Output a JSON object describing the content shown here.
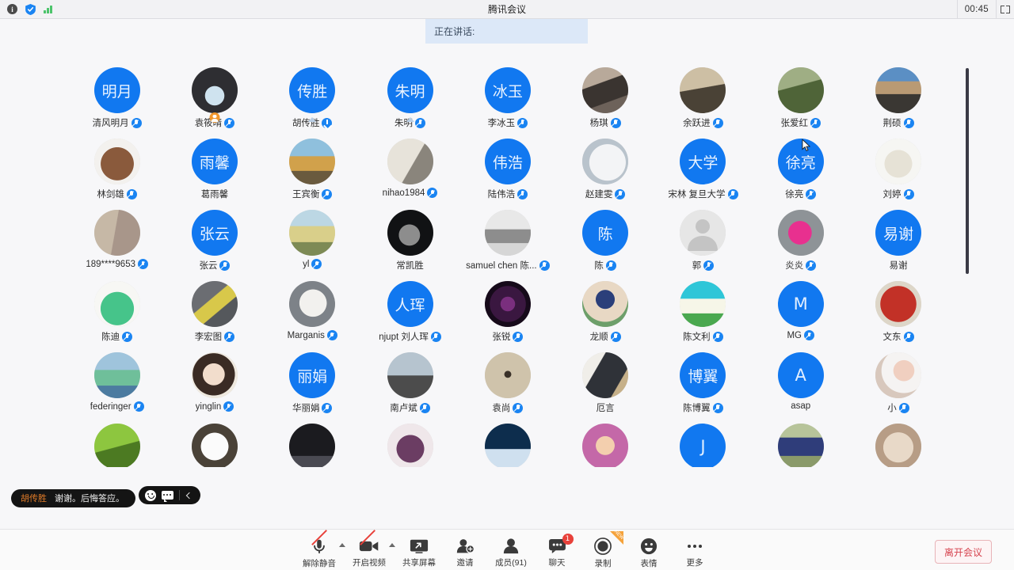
{
  "titlebar": {
    "title": "腾讯会议",
    "timer": "00:45",
    "info_icon": "info-icon",
    "shield_icon": "shield-icon",
    "signal_icon": "signal-bars-icon",
    "expand_icon": "fullscreen-icon"
  },
  "speaking_banner": {
    "text": "正在讲话:"
  },
  "participants": [
    {
      "name": "清风明月",
      "avatar_type": "initial",
      "initials": "明月",
      "mic": "muted"
    },
    {
      "name": "袁筱晴",
      "avatar_type": "photo",
      "photo": "dark-portrait",
      "mic": "muted",
      "badge": "host"
    },
    {
      "name": "胡传胜",
      "avatar_type": "initial",
      "initials": "传胜",
      "mic": "arrow",
      "badge": "triangle"
    },
    {
      "name": "朱明",
      "avatar_type": "initial",
      "initials": "朱明",
      "mic": "muted",
      "badge": "triangle"
    },
    {
      "name": "李冰玉",
      "avatar_type": "initial",
      "initials": "冰玉",
      "mic": "muted"
    },
    {
      "name": "杨琪",
      "avatar_type": "photo",
      "photo": "street-scene",
      "mic": "muted"
    },
    {
      "name": "余跃进",
      "avatar_type": "photo",
      "photo": "sphinx-man",
      "mic": "muted"
    },
    {
      "name": "张爱红",
      "avatar_type": "photo",
      "photo": "cyclist",
      "mic": "muted"
    },
    {
      "name": "荆硕",
      "avatar_type": "photo",
      "photo": "dog-desert",
      "mic": "muted"
    },
    {
      "name": "林剑雄",
      "avatar_type": "photo",
      "photo": "brown-bear",
      "mic": "muted"
    },
    {
      "name": "葛雨馨",
      "avatar_type": "initial",
      "initials": "雨馨",
      "mic": "none"
    },
    {
      "name": "王宾衡",
      "avatar_type": "photo",
      "photo": "bigben-autumn",
      "mic": "muted"
    },
    {
      "name": "nihao1984",
      "avatar_type": "photo",
      "photo": "calligraphy",
      "mic": "muted"
    },
    {
      "name": "陆伟浩",
      "avatar_type": "initial",
      "initials": "伟浩",
      "mic": "muted"
    },
    {
      "name": "赵建雯",
      "avatar_type": "photo",
      "photo": "white-cat-flower",
      "mic": "muted"
    },
    {
      "name": "宋林 复旦大学",
      "avatar_type": "initial",
      "initials": "大学",
      "mic": "muted"
    },
    {
      "name": "徐亮",
      "avatar_type": "initial",
      "initials": "徐亮",
      "mic": "muted"
    },
    {
      "name": "刘婷",
      "avatar_type": "photo",
      "photo": "illustration-girl",
      "mic": "muted"
    },
    {
      "name": "189****9653",
      "avatar_type": "photo",
      "photo": "red-ribbon",
      "mic": "muted"
    },
    {
      "name": "张云",
      "avatar_type": "initial",
      "initials": "张云",
      "mic": "muted"
    },
    {
      "name": "yl",
      "avatar_type": "photo",
      "photo": "field-landscape",
      "mic": "muted"
    },
    {
      "name": "常凯胜",
      "avatar_type": "photo",
      "photo": "man-glasses-dark",
      "mic": "none"
    },
    {
      "name": "samuel chen 陈...",
      "avatar_type": "photo",
      "photo": "bw-dancing",
      "mic": "muted"
    },
    {
      "name": "陈",
      "avatar_type": "initial",
      "initials": "陈",
      "mic": "muted"
    },
    {
      "name": "郭",
      "avatar_type": "photo",
      "photo": "default-user",
      "mic": "muted"
    },
    {
      "name": "炎炎",
      "avatar_type": "photo",
      "photo": "pink-flower",
      "mic": "muted"
    },
    {
      "name": "易谢",
      "avatar_type": "initial",
      "initials": "易谢",
      "mic": "none"
    },
    {
      "name": "陈迪",
      "avatar_type": "photo",
      "photo": "cartoon-dino-girl",
      "mic": "muted"
    },
    {
      "name": "李宏图",
      "avatar_type": "photo",
      "photo": "yellow-blossom",
      "mic": "muted"
    },
    {
      "name": "Marganis",
      "avatar_type": "photo",
      "photo": "cartoon-wolf",
      "mic": "muted"
    },
    {
      "name": "njupt 刘人珲",
      "avatar_type": "initial",
      "initials": "人珲",
      "mic": "muted"
    },
    {
      "name": "张锐",
      "avatar_type": "photo",
      "photo": "purple-mandala",
      "mic": "muted"
    },
    {
      "name": "龙顺",
      "avatar_type": "photo",
      "photo": "cartoon-boy-hat",
      "mic": "muted"
    },
    {
      "name": "陈文利",
      "avatar_type": "photo",
      "photo": "daisy-lake",
      "mic": "muted"
    },
    {
      "name": "MG",
      "avatar_type": "initial",
      "initials": "M",
      "mic": "muted"
    },
    {
      "name": "文东",
      "avatar_type": "photo",
      "photo": "red-seal",
      "mic": "muted"
    },
    {
      "name": "federinger",
      "avatar_type": "photo",
      "photo": "statue-liberty",
      "mic": "muted"
    },
    {
      "name": "yinglin",
      "avatar_type": "photo",
      "photo": "child-portrait",
      "mic": "muted"
    },
    {
      "name": "华丽娟",
      "avatar_type": "initial",
      "initials": "丽娟",
      "mic": "muted"
    },
    {
      "name": "南卢斌",
      "avatar_type": "photo",
      "photo": "mountain-person",
      "mic": "muted"
    },
    {
      "name": "袁尚",
      "avatar_type": "photo",
      "photo": "beige-abstract",
      "mic": "muted"
    },
    {
      "name": "厄言",
      "avatar_type": "photo",
      "photo": "man-reading",
      "mic": "none"
    },
    {
      "name": "陈博翼",
      "avatar_type": "initial",
      "initials": "博翼",
      "mic": "muted"
    },
    {
      "name": "asap",
      "avatar_type": "initial",
      "initials": "A",
      "mic": "none"
    },
    {
      "name": "小",
      "avatar_type": "photo",
      "photo": "girl-with-dog",
      "mic": "muted"
    },
    {
      "name": "",
      "avatar_type": "photo",
      "photo": "green-leaves",
      "mic": "none",
      "partial": true
    },
    {
      "name": "",
      "avatar_type": "photo",
      "photo": "white-cat",
      "mic": "none",
      "partial": true
    },
    {
      "name": "",
      "avatar_type": "photo",
      "photo": "dark-figure",
      "mic": "none",
      "partial": true
    },
    {
      "name": "",
      "avatar_type": "photo",
      "photo": "purple-hair",
      "mic": "none",
      "partial": true
    },
    {
      "name": "",
      "avatar_type": "photo",
      "photo": "night-sky",
      "mic": "none",
      "partial": true
    },
    {
      "name": "",
      "avatar_type": "photo",
      "photo": "anime-girl",
      "mic": "none",
      "partial": true
    },
    {
      "name": "",
      "avatar_type": "initial",
      "initials": "J",
      "mic": "none",
      "partial": true
    },
    {
      "name": "",
      "avatar_type": "photo",
      "photo": "tennis-player",
      "mic": "none",
      "partial": true
    },
    {
      "name": "",
      "avatar_type": "photo",
      "photo": "scottish-fold-cat",
      "mic": "none",
      "partial": true
    }
  ],
  "chat_overlay": {
    "sender": "胡传胜",
    "message": "谢谢。后悔答应。",
    "emoji_icon": "smiley-icon",
    "chat_icon": "chat-bubble-icon",
    "collapse_icon": "chevron-left-icon"
  },
  "toolbar": {
    "items": [
      {
        "label": "解除静音",
        "icon": "mic-muted-icon",
        "has_caret": true,
        "slashed": true
      },
      {
        "label": "开启视频",
        "icon": "camera-off-icon",
        "has_caret": true,
        "slashed": true
      },
      {
        "label": "共享屏幕",
        "icon": "share-screen-icon",
        "has_caret": false,
        "slashed": false
      },
      {
        "label": "邀请",
        "icon": "invite-user-icon",
        "has_caret": false,
        "slashed": false
      },
      {
        "label": "成员(91)",
        "icon": "participants-icon",
        "has_caret": false,
        "slashed": false
      },
      {
        "label": "聊天",
        "icon": "chat-icon",
        "has_caret": false,
        "slashed": false,
        "badge": "1"
      },
      {
        "label": "录制",
        "icon": "record-icon",
        "has_caret": false,
        "slashed": false,
        "flag": "NEW"
      },
      {
        "label": "表情",
        "icon": "emoji-icon",
        "has_caret": false,
        "slashed": false
      },
      {
        "label": "更多",
        "icon": "more-dots-icon",
        "has_caret": false,
        "slashed": false
      }
    ],
    "leave_label": "离开会议"
  },
  "colors": {
    "accent_blue": "#1178f0",
    "banner_blue": "#dce8f8",
    "leave_red": "#d6434f",
    "badge_red": "#e8413a",
    "host_orange": "#f0962b"
  }
}
